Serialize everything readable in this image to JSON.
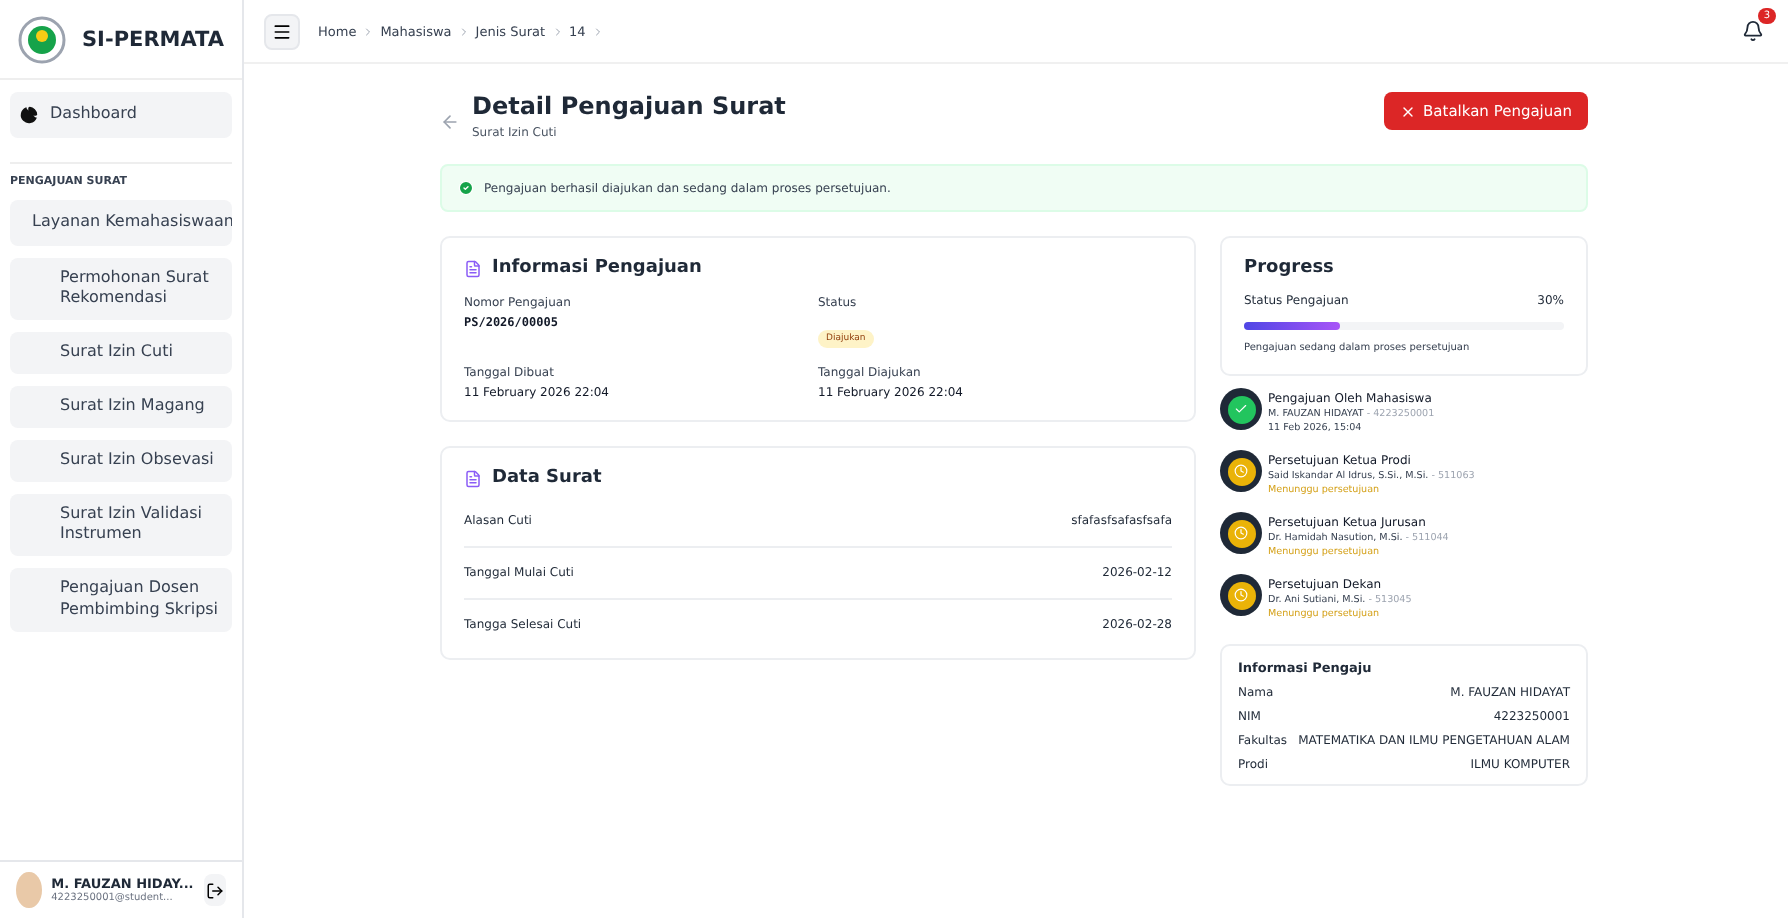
{
  "app": {
    "name": "SI-PERMATA"
  },
  "sidebar": {
    "dashboard": "Dashboard",
    "section": "PENGAJUAN SURAT",
    "group": {
      "label": "Layanan Kemahasiswaan",
      "items": [
        "Permohonan Surat Rekomendasi",
        "Surat Izin Cuti",
        "Surat Izin Magang",
        "Surat Izin Obsevasi",
        "Surat Izin Validasi Instrumen",
        "Pengajuan Dosen Pembimbing Skripsi"
      ]
    },
    "user": {
      "name": "M. FAUZAN HIDAY...",
      "email": "4223250001@student..."
    }
  },
  "breadcrumb": [
    "Home",
    "Mahasiswa",
    "Jenis Surat",
    "14"
  ],
  "notifications": {
    "count": "3"
  },
  "page": {
    "title": "Detail Pengajuan Surat",
    "subtitle": "Surat Izin Cuti",
    "cancel_button": "Batalkan Pengajuan"
  },
  "alert": "Pengajuan berhasil diajukan dan sedang dalam proses persetujuan.",
  "info": {
    "title": "Informasi Pengajuan",
    "fields": [
      {
        "label": "Nomor Pengajuan",
        "value": "PS/2026/00005",
        "kind": "mono"
      },
      {
        "label": "Status",
        "value": "Diajukan",
        "kind": "badge"
      },
      {
        "label": "Tanggal Dibuat",
        "value": "11 February 2026 22:04",
        "kind": "text"
      },
      {
        "label": "Tanggal Diajukan",
        "value": "11 February 2026 22:04",
        "kind": "text"
      }
    ]
  },
  "data_surat": {
    "title": "Data Surat",
    "rows": [
      {
        "label": "Alasan Cuti",
        "value": "sfafasfsafasfsafa"
      },
      {
        "label": "Tanggal Mulai Cuti",
        "value": "2026-02-12"
      },
      {
        "label": "Tangga Selesai Cuti",
        "value": "2026-02-28"
      }
    ]
  },
  "progress": {
    "title": "Progress",
    "label": "Status Pengajuan",
    "percent": "30%",
    "level": 0.3,
    "note": "Pengajuan sedang dalam proses persetujuan"
  },
  "timeline": [
    {
      "kind": "done",
      "title": "Pengajuan Oleh Mahasiswa",
      "person": "M. FAUZAN HIDAYAT",
      "id": "- 4223250001",
      "status": "11 Feb 2026, 15:04"
    },
    {
      "kind": "pending",
      "title": "Persetujuan Ketua Prodi",
      "person": "Said Iskandar Al Idrus, S.Si., M.Si.",
      "id": "- 511063",
      "status": "Menunggu persetujuan"
    },
    {
      "kind": "pending",
      "title": "Persetujuan Ketua Jurusan",
      "person": "Dr. Hamidah Nasution, M.Si.",
      "id": "- 511044",
      "status": "Menunggu persetujuan"
    },
    {
      "kind": "pending",
      "title": "Persetujuan Dekan",
      "person": "Dr. Ani Sutiani, M.Si.",
      "id": "- 513045",
      "status": "Menunggu persetujuan"
    }
  ],
  "pengaju": {
    "title": "Informasi Pengaju",
    "rows": [
      {
        "label": "Nama",
        "value": "M. FAUZAN HIDAYAT"
      },
      {
        "label": "NIM",
        "value": "4223250001"
      },
      {
        "label": "Fakultas",
        "value": "MATEMATIKA DAN ILMU PENGETAHUAN ALAM"
      },
      {
        "label": "Prodi",
        "value": "ILMU KOMPUTER"
      }
    ]
  }
}
